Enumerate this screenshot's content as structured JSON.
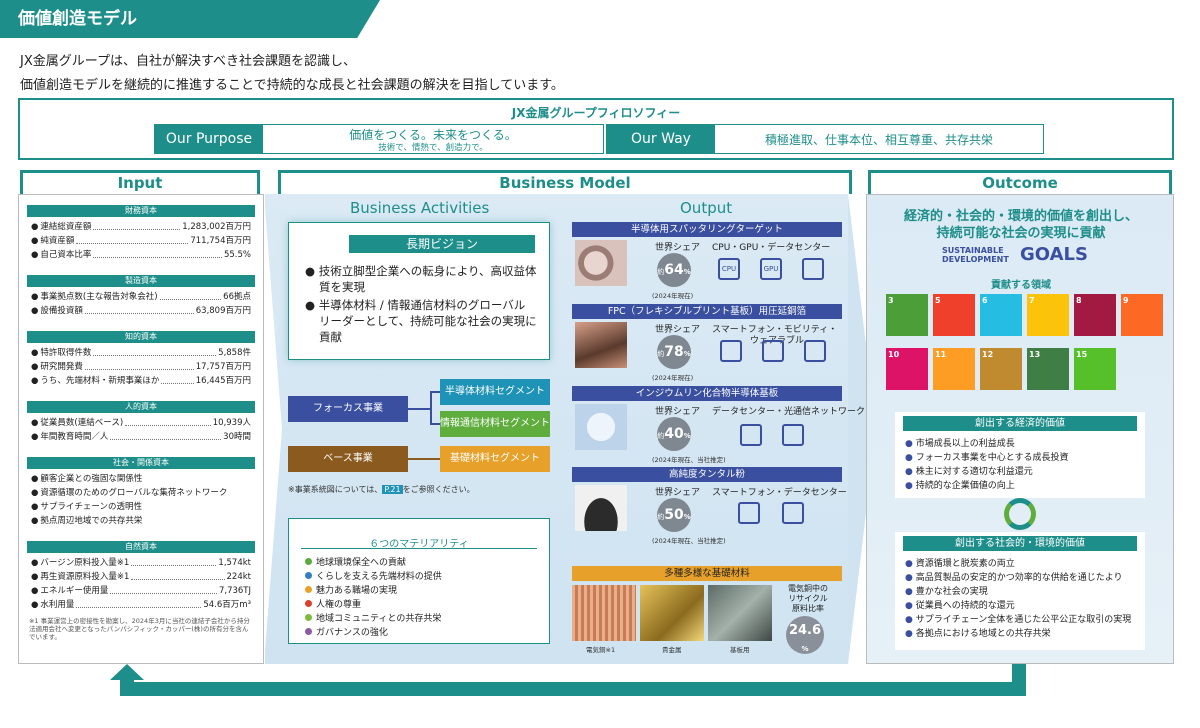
{
  "header": {
    "title": "価値創造モデル"
  },
  "intro": {
    "line1": "JX金属グループは、自社が解決すべき社会課題を認識し、",
    "line2": "価値創造モデルを継続的に推進することで持続的な成長と社会課題の解決を目指しています。"
  },
  "philosophy": {
    "title": "JX金属グループフィロソフィー",
    "purpose_label": "Our Purpose",
    "purpose_main": "価値をつくる。未来をつくる。",
    "purpose_sub": "技術で、情熱で、創造力で。",
    "way_label": "Our Way",
    "way_text": "積極進取、仕事本位、相互尊重、共存共栄"
  },
  "columns": {
    "input": "Input",
    "business": "Business Model",
    "outcome": "Outcome"
  },
  "input": {
    "groups": [
      {
        "head": "財務資本",
        "rows": [
          [
            "連結総資産額",
            "1,283,002百万円"
          ],
          [
            "純資産額",
            "711,754百万円"
          ],
          [
            "自己資本比率",
            "55.5%"
          ]
        ]
      },
      {
        "head": "製造資本",
        "rows": [
          [
            "事業拠点数(主な報告対象会社)",
            "66拠点"
          ],
          [
            "設備投資額",
            "63,809百万円"
          ]
        ]
      },
      {
        "head": "知的資本",
        "rows": [
          [
            "特許取得件数",
            "5,858件"
          ],
          [
            "研究開発費",
            "17,757百万円"
          ],
          [
            "うち、先端材料・新規事業ほか",
            "16,445百万円"
          ]
        ]
      },
      {
        "head": "人的資本",
        "rows": [
          [
            "従業員数(連結ベース)",
            "10,939人"
          ],
          [
            "年間教育時間／人",
            "30時間"
          ]
        ]
      },
      {
        "head": "社会・関係資本",
        "rows": [
          [
            "顧客企業との強固な関係性",
            ""
          ],
          [
            "資源循環のためのグローバルな集荷ネットワーク",
            ""
          ],
          [
            "サプライチェーンの透明性",
            ""
          ],
          [
            "拠点周辺地域での共存共栄",
            ""
          ]
        ]
      },
      {
        "head": "自然資本",
        "rows": [
          [
            "バージン原料投入量※1",
            "1,574kt"
          ],
          [
            "再生資源原料投入量※1",
            "224kt"
          ],
          [
            "エネルギー使用量",
            "7,736TJ"
          ],
          [
            "水利用量",
            "54.6百万m³"
          ]
        ]
      }
    ],
    "note": "※1 事業運営上の密接性を勘案し、2024年3月に当社の連結子会社から持分法適用会社へ変更となったパンパシフィック・カッパー(株)の所有分を含んでいます。"
  },
  "business": {
    "activities_title": "Business Activities",
    "vision_title": "長期ビジョン",
    "vision_b1a": "技術立脚型企業への転身により、高収益体",
    "vision_b1b": "質を実現",
    "vision_b2a": "半導体材料 / 情報通信材料のグローバル",
    "vision_b2b": "リーダーとして、持続可能な社会の実現に",
    "vision_b2c": "貢献",
    "focus": "フォーカス事業",
    "base": "ベース事業",
    "seg1": "半導体材料セグメント",
    "seg2": "情報通信材料セグメント",
    "seg3": "基礎材料セグメント",
    "note_a": "※事業系統図については、",
    "note_page": "P.21",
    "note_b": "をご参照ください。",
    "mat_title": "６つのマテリアリティ",
    "materialities": [
      {
        "label": "地球環境保全への貢献",
        "color": "#5aa93c"
      },
      {
        "label": "くらしを支える先端材料の提供",
        "color": "#2f7fc1"
      },
      {
        "label": "魅力ある職場の実現",
        "color": "#e7a12a"
      },
      {
        "label": "人権の尊重",
        "color": "#d9412c"
      },
      {
        "label": "地域コミュニティとの共存共栄",
        "color": "#7dbb3c"
      },
      {
        "label": "ガバナンスの強化",
        "color": "#8a5aa8"
      }
    ]
  },
  "output": {
    "title": "Output",
    "share_label": "世界シェア",
    "approx": "約",
    "percent": "%",
    "items": [
      {
        "head": "半導体用スパッタリングターゲット",
        "share": "64",
        "date": "(2024年現在)",
        "devices": "CPU・GPU・データセンター"
      },
      {
        "head": "FPC（フレキシブルプリント基板）用圧延銅箔",
        "share": "78",
        "date": "(2024年現在)",
        "devices": "スマートフォン・モビリティ・",
        "devices2": "ウェアラブル"
      },
      {
        "head": "インジウムリン化合物半導体基板",
        "share": "40",
        "date": "(2024年現在、当社推定)",
        "devices": "データセンター・光通信ネットワーク"
      },
      {
        "head": "高純度タンタル粉",
        "share": "50",
        "date": "(2024年現在、当社推定)",
        "devices": "スマートフォン・データセンター"
      }
    ],
    "icon_cpu": "CPU",
    "icon_gpu": "GPU",
    "basic_head": "多種多様な基礎材料",
    "photo1": "電気銅※1",
    "photo2": "貴金属",
    "photo3": "基板用",
    "recycle1": "電気銅中の",
    "recycle2": "リサイクル",
    "recycle3": "原料比率",
    "recycle_val": "24.6",
    "recycle_pct": "%"
  },
  "outcome": {
    "headline1": "経済的・社会的・環境的価値を創出し、",
    "headline2": "持続可能な社会の実現に貢献",
    "sdg_logo1": "SUSTAINABLE",
    "sdg_logo2": "DEVELOPMENT",
    "sdg_logo3": "GOALS",
    "contrib": "貢献する領域",
    "sdgs": [
      {
        "num": "3",
        "color": "#4c9f38"
      },
      {
        "num": "5",
        "color": "#ef402b"
      },
      {
        "num": "6",
        "color": "#26bde2"
      },
      {
        "num": "7",
        "color": "#fcc30b"
      },
      {
        "num": "8",
        "color": "#a21942"
      },
      {
        "num": "9",
        "color": "#fd6925"
      },
      {
        "num": "10",
        "color": "#dd1367"
      },
      {
        "num": "11",
        "color": "#fd9d24"
      },
      {
        "num": "12",
        "color": "#bf8b2e"
      },
      {
        "num": "13",
        "color": "#3f7e44"
      },
      {
        "num": "15",
        "color": "#56c02b"
      }
    ],
    "econ_head": "創出する経済的価値",
    "econ": [
      "市場成長以上の利益成長",
      "フォーカス事業を中心とする成長投資",
      "株主に対する適切な利益還元",
      "持続的な企業価値の向上"
    ],
    "soc_head": "創出する社会的・環境的価値",
    "soc": [
      "資源循環と脱炭素の両立",
      "高品質製品の安定的かつ効率的な供給を通じたより",
      "豊かな社会の実現",
      "従業員への持続的な還元",
      "サプライチェーン全体を通じた公平公正な取引の実現",
      "各拠点における地域との共存共栄"
    ]
  },
  "colors": {
    "teal": "#1e8e8a",
    "navy": "#3a4fa0",
    "seg_blue": "#1f93b7",
    "seg_green": "#5fae3d",
    "seg_orange": "#e7a12a",
    "focus": "#3a4fa0",
    "base": "#8a5a1e"
  }
}
